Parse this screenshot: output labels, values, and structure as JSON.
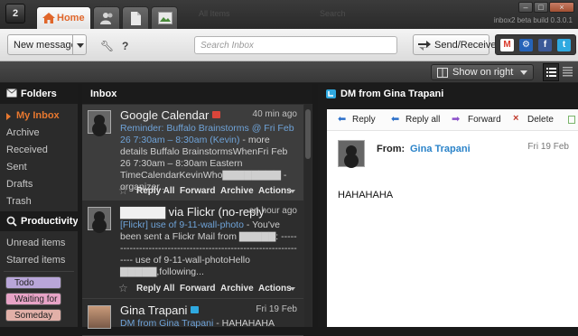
{
  "titlebar": {
    "home_tab_label": "Home",
    "ghost_tab_1": "All Items",
    "ghost_tab_2": "Search",
    "version": "inbox2 beta build 0.3.0.1",
    "logo_label": "2"
  },
  "toolbar": {
    "new_message_label": "New message",
    "search_placeholder": "Search Inbox",
    "send_receive_label": "Send/Receive",
    "accounts": [
      {
        "name": "gmail-icon",
        "glyph": "M",
        "color": "#d93a2b"
      },
      {
        "name": "hyves-icon",
        "glyph": "⚙",
        "color": "#2563b8"
      },
      {
        "name": "facebook-icon",
        "glyph": "f",
        "color": "#3b5998"
      },
      {
        "name": "twitter-icon",
        "glyph": "t",
        "color": "#2fa9e0"
      }
    ]
  },
  "viewbar": {
    "show_on_right_label": "Show on right"
  },
  "sidebar": {
    "folders_header": "Folders",
    "folders": [
      "My Inbox",
      "Archive",
      "Received",
      "Sent",
      "Drafts",
      "Trash"
    ],
    "productivity_header": "Productivity",
    "productivity": [
      "Unread items",
      "Starred items"
    ],
    "labels": [
      {
        "text": "Todo",
        "color": "#b9a6d9"
      },
      {
        "text": "Waiting for",
        "color": "#e7a3c6"
      },
      {
        "text": "Someday",
        "color": "#e2b0a8"
      }
    ]
  },
  "inbox": {
    "header": "Inbox",
    "messages": [
      {
        "sender": "Google Calendar",
        "time": "40 min ago",
        "subject": "Reminder: Buffalo Brainstorms @ Fri Feb 26 7:30am – 8:30am (Kevin)",
        "body": " - more details Buffalo BrainstormsWhenFri Feb 26 7:30am – 8:30am Eastern TimeCalendarKevinWho▇▇▇▇▇▇▇▇ - organizer...",
        "reply_all": "Reply All",
        "forward": "Forward",
        "archive": "Archive",
        "actions": "Actions"
      },
      {
        "sender": "▇▇▇▇▇ via Flickr (no-reply",
        "time": "an hour ago",
        "subject": "[Flickr] use of 9-11-wall-photo",
        "body": " - You've been sent a Flickr Mail from ▇▇▇▇▇: ----------------------------------------------------------------- use of 9-11-wall-photoHello ▇▇▇▇▇,following...",
        "reply_all": "Reply All",
        "forward": "Forward",
        "archive": "Archive",
        "actions": "Actions"
      },
      {
        "sender": "Gina Trapani",
        "time": "Fri 19 Feb",
        "subject": "DM from Gina Trapani",
        "body": " - HAHAHAHA"
      }
    ]
  },
  "pane": {
    "title": "DM from Gina Trapani",
    "reply": "Reply",
    "reply_all": "Reply all",
    "forward": "Forward",
    "delete": "Delete",
    "from_label": "From:",
    "from_name": "Gina Trapani",
    "date": "Fri 19 Feb",
    "body": "HAHAHAHA"
  }
}
